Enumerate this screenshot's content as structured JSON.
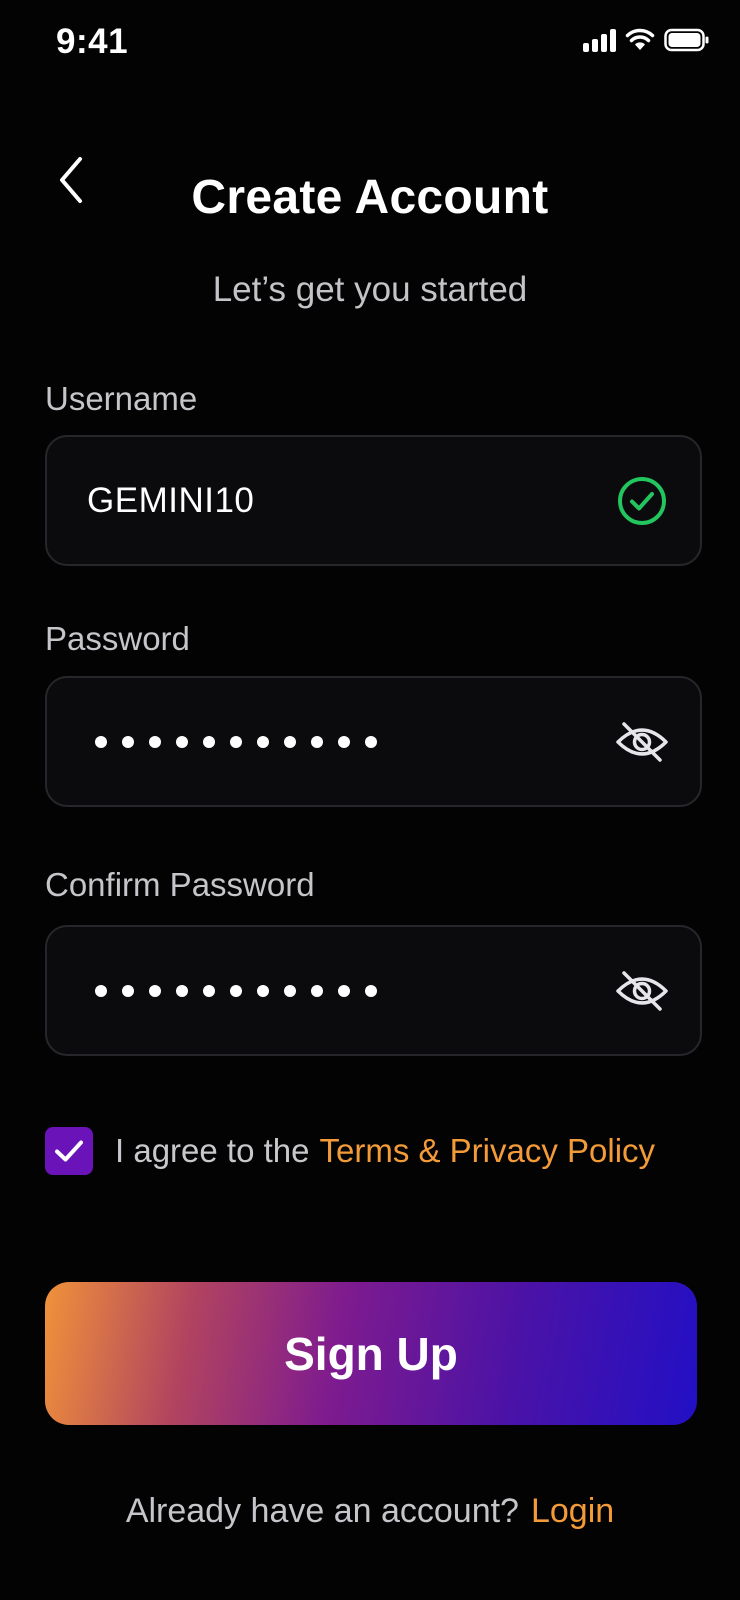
{
  "status_bar": {
    "time": "9:41",
    "icons": [
      "signal-icon",
      "wifi-icon",
      "battery-icon"
    ]
  },
  "header": {
    "back_icon": "chevron-left-icon",
    "title": "Create Account",
    "subtitle": "Let’s get you started"
  },
  "form": {
    "username": {
      "label": "Username",
      "value": "GEMINI10",
      "status_icon": "check-circle-icon",
      "status_color": "#22c55e"
    },
    "password": {
      "label": "Password",
      "masked_length": 11,
      "toggle_icon": "eye-off-icon"
    },
    "confirm_password": {
      "label": "Confirm Password",
      "masked_length": 11,
      "toggle_icon": "eye-off-icon"
    },
    "terms": {
      "checked": true,
      "text": "I agree to the",
      "link_text": "Terms & Privacy Policy"
    },
    "submit_label": "Sign Up"
  },
  "footer": {
    "prompt": "Already have an account?",
    "link_text": "Login"
  },
  "colors": {
    "background": "#030304",
    "accent_link": "#f39b38",
    "checkbox": "#6a13b8",
    "button_gradient": [
      "#f0923a",
      "#7e1b8f",
      "#2210c5"
    ]
  }
}
